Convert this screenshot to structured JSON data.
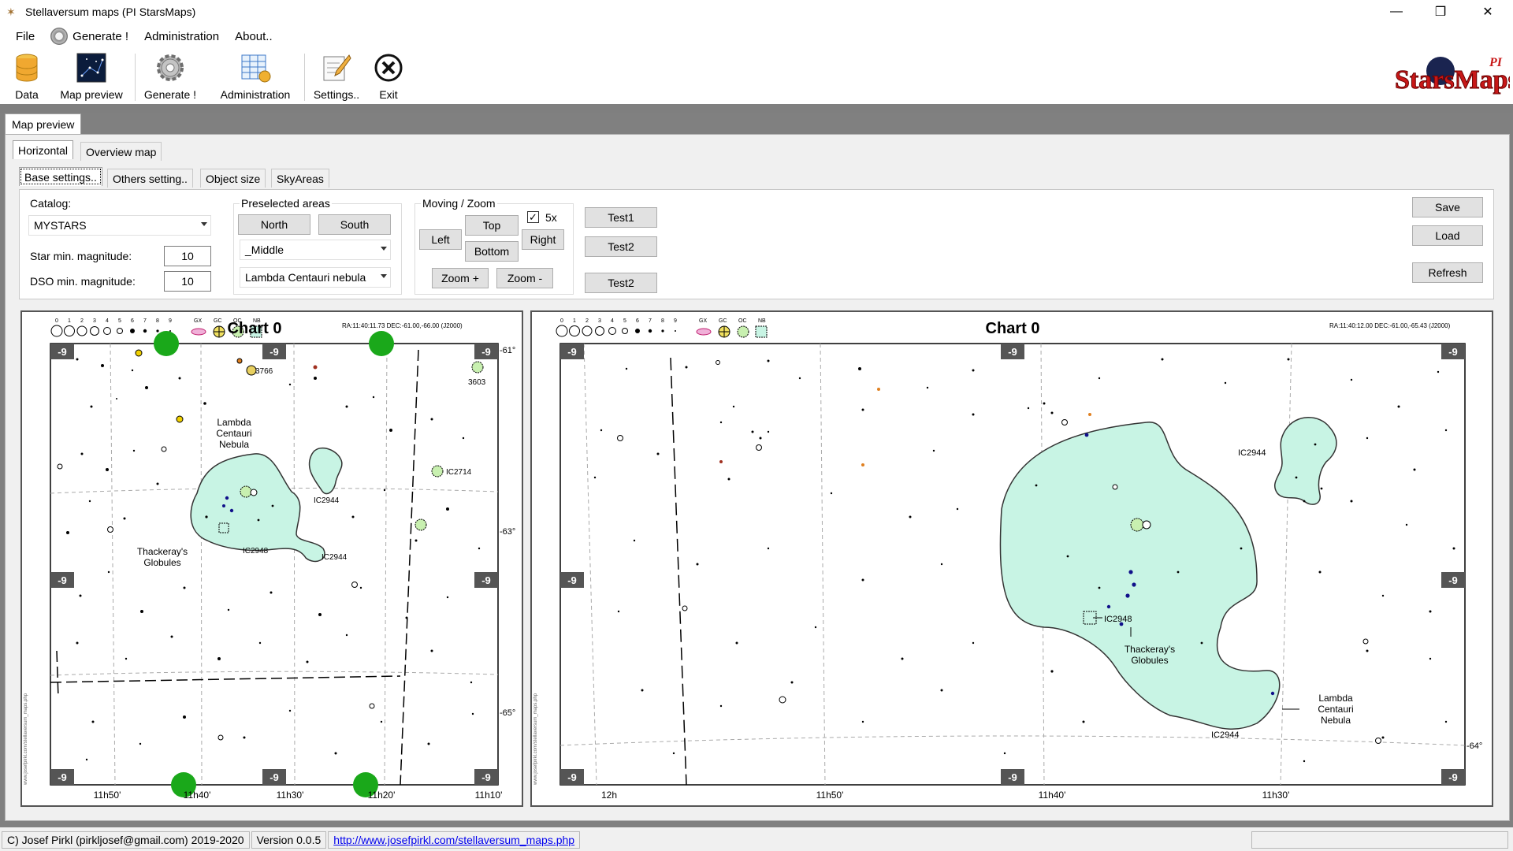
{
  "window": {
    "title": "Stellaversum maps (PI StarsMaps)",
    "minimize": "—",
    "maximize": "❒",
    "close": "✕"
  },
  "menu": {
    "file": "File",
    "generate": "Generate !",
    "administration": "Administration",
    "about": "About.."
  },
  "toolbar": {
    "data": "Data",
    "map_preview": "Map preview",
    "generate": "Generate !",
    "administration": "Administration",
    "settings": "Settings..",
    "exit": "Exit",
    "logo_text": "StarsMaps",
    "logo_pi": "PI"
  },
  "tabs": {
    "outer": "Map preview",
    "view": [
      "Horizontal",
      "Overview map"
    ],
    "settings": [
      "Base settings..",
      "Others setting..",
      "Object size",
      "SkyAreas"
    ]
  },
  "settings": {
    "catalog_label": "Catalog:",
    "catalog_value": "MYSTARS",
    "star_mag_label": "Star min. magnitude:",
    "star_mag_value": "10",
    "dso_mag_label": "DSO min. magnitude:",
    "dso_mag_value": "10",
    "preselected_label": "Preselected areas",
    "north": "North",
    "south": "South",
    "area_value": "_Middle",
    "object_value": "Lambda Centauri nebula",
    "moving_label": "Moving / Zoom",
    "five_x_label": "5x",
    "five_x_checked": "✓",
    "left": "Left",
    "top": "Top",
    "right": "Right",
    "bottom": "Bottom",
    "zoom_in": "Zoom +",
    "zoom_out": "Zoom -",
    "test1": "Test1",
    "test2a": "Test2",
    "test2b": "Test2",
    "save": "Save",
    "load": "Load",
    "refresh": "Refresh"
  },
  "chart_left": {
    "title": "Chart 0",
    "coords": "RA:11:40:11.73  DEC:-61.00,-66.00  (J2000)",
    "mag_legend": [
      "0",
      "1",
      "2",
      "3",
      "4",
      "5",
      "6",
      "7",
      "8",
      "9"
    ],
    "type_legend": [
      "GX",
      "GC",
      "OC",
      "NB"
    ],
    "ra_labels": [
      "11h50'",
      "11h40'",
      "11h30'",
      "11h20'",
      "11h10'"
    ],
    "dec_labels": [
      "-61°",
      "-63°",
      "-65°"
    ],
    "page_marker": "-9",
    "objects": [
      "3766",
      "3603",
      "IC2714",
      "IC2944",
      "IC2948",
      "IC2944"
    ],
    "nebula_label": [
      "Lambda",
      "Centauri",
      "Nebula"
    ],
    "globules_label": [
      "Thackeray's",
      "Globules"
    ],
    "side_url": "www.josefpirkl.com/stellaversum_maps.php"
  },
  "chart_right": {
    "title": "Chart 0",
    "coords": "RA:11:40:12.00  DEC:-61.00,-65.43  (J2000)",
    "mag_legend": [
      "0",
      "1",
      "2",
      "3",
      "4",
      "5",
      "6",
      "7",
      "8",
      "9"
    ],
    "type_legend": [
      "GX",
      "GC",
      "OC",
      "NB"
    ],
    "ra_labels": [
      "12h",
      "11h50'",
      "11h40'",
      "11h30'"
    ],
    "dec_labels": [
      "-64°"
    ],
    "page_marker": "-9",
    "objects": [
      "IC2944",
      "IC2948",
      "IC2944"
    ],
    "nebula_label": [
      "Lambda",
      "Centauri",
      "Nebula"
    ],
    "globules_label": [
      "Thackeray's",
      "Globules"
    ],
    "side_url": "www.josefpirkl.com/stellaversum_maps.php"
  },
  "status": {
    "copyright": "C) Josef Pirkl (pirkljosef@gmail.com) 2019-2020",
    "version": "Version 0.0.5",
    "url": "http://www.josefpirkl.com/stellaversum_maps.php"
  },
  "colors": {
    "nebula_fill": "#c8f4e4",
    "nebula_stroke": "#333333",
    "cluster_green": "#009a00",
    "marker_bg": "#555555"
  }
}
